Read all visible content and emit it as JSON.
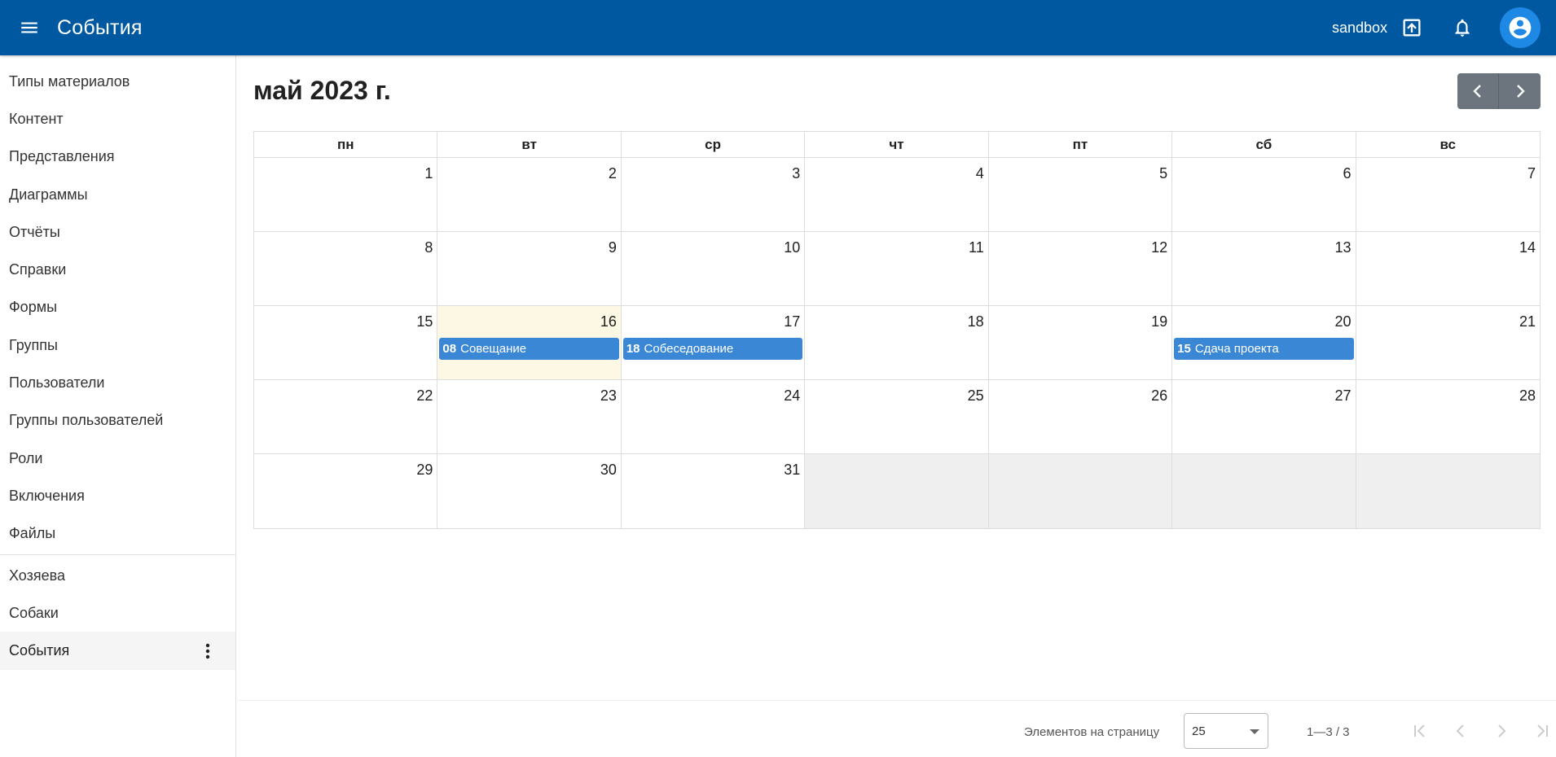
{
  "header": {
    "title": "События",
    "env_label": "sandbox",
    "colors": {
      "bar": "#0059a0",
      "avatar": "#1e88e5"
    },
    "icons": [
      "menu-icon",
      "upload-icon",
      "bell-icon",
      "account-circle-icon"
    ]
  },
  "sidebar": {
    "items": [
      {
        "label": "Типы материалов"
      },
      {
        "label": "Контент"
      },
      {
        "label": "Представления"
      },
      {
        "label": "Диаграммы"
      },
      {
        "label": "Отчёты"
      },
      {
        "label": "Справки"
      },
      {
        "label": "Формы"
      },
      {
        "label": "Группы"
      },
      {
        "label": "Пользователи"
      },
      {
        "label": "Группы пользователей"
      },
      {
        "label": "Роли"
      },
      {
        "label": "Включения"
      },
      {
        "label": "Файлы"
      }
    ],
    "extra_items": [
      {
        "label": "Хозяева"
      },
      {
        "label": "Собаки"
      },
      {
        "label": "События",
        "active": true
      }
    ]
  },
  "calendar": {
    "title": "май 2023 г.",
    "weekdays": [
      "пн",
      "вт",
      "ср",
      "чт",
      "пт",
      "сб",
      "вс"
    ],
    "today": "16",
    "weeks": [
      [
        "1",
        "2",
        "3",
        "4",
        "5",
        "6",
        "7"
      ],
      [
        "8",
        "9",
        "10",
        "11",
        "12",
        "13",
        "14"
      ],
      [
        "15",
        "16",
        "17",
        "18",
        "19",
        "20",
        "21"
      ],
      [
        "22",
        "23",
        "24",
        "25",
        "26",
        "27",
        "28"
      ],
      [
        "29",
        "30",
        "31",
        "",
        "",
        "",
        ""
      ]
    ],
    "events": [
      {
        "day": "16",
        "time": "08",
        "title": "Совещание"
      },
      {
        "day": "17",
        "time": "18",
        "title": "Собеседование"
      },
      {
        "day": "20",
        "time": "15",
        "title": "Сдача проекта"
      }
    ],
    "event_color": "#3a87d6",
    "today_color": "#fcf8e3"
  },
  "paginator": {
    "label": "Элементов на страницу",
    "page_size": "25",
    "range": "1—3 / 3"
  }
}
